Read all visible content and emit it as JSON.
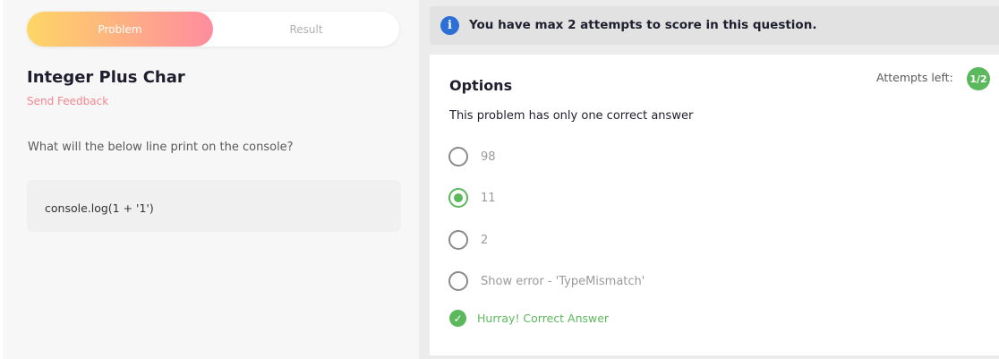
{
  "tabs": {
    "problem": "Problem",
    "result": "Result"
  },
  "problem": {
    "title": "Integer Plus Char",
    "feedback": "Send Feedback",
    "question": "What will the below line print on the console?",
    "code": "console.log(1 + '1')"
  },
  "info_bar": {
    "icon": "info-icon",
    "text": "You have max 2 attempts to score in this question."
  },
  "options": {
    "title": "Options",
    "attempts_label": "Attempts left:",
    "attempts_value": "1/2",
    "instruction": "This problem has only one correct answer",
    "items": [
      {
        "label": "98",
        "checked": false
      },
      {
        "label": "11",
        "checked": true
      },
      {
        "label": "2",
        "checked": false
      },
      {
        "label": "Show error - 'TypeMismatch'",
        "checked": false
      }
    ],
    "result_text": "Hurray! Correct Answer"
  },
  "colors": {
    "accent_green": "#5cb85c",
    "feedback_pink": "#f4858f",
    "info_blue": "#2e6fd6",
    "tab_gradient_start": "#fdd666",
    "tab_gradient_end": "#ff8c9e"
  }
}
